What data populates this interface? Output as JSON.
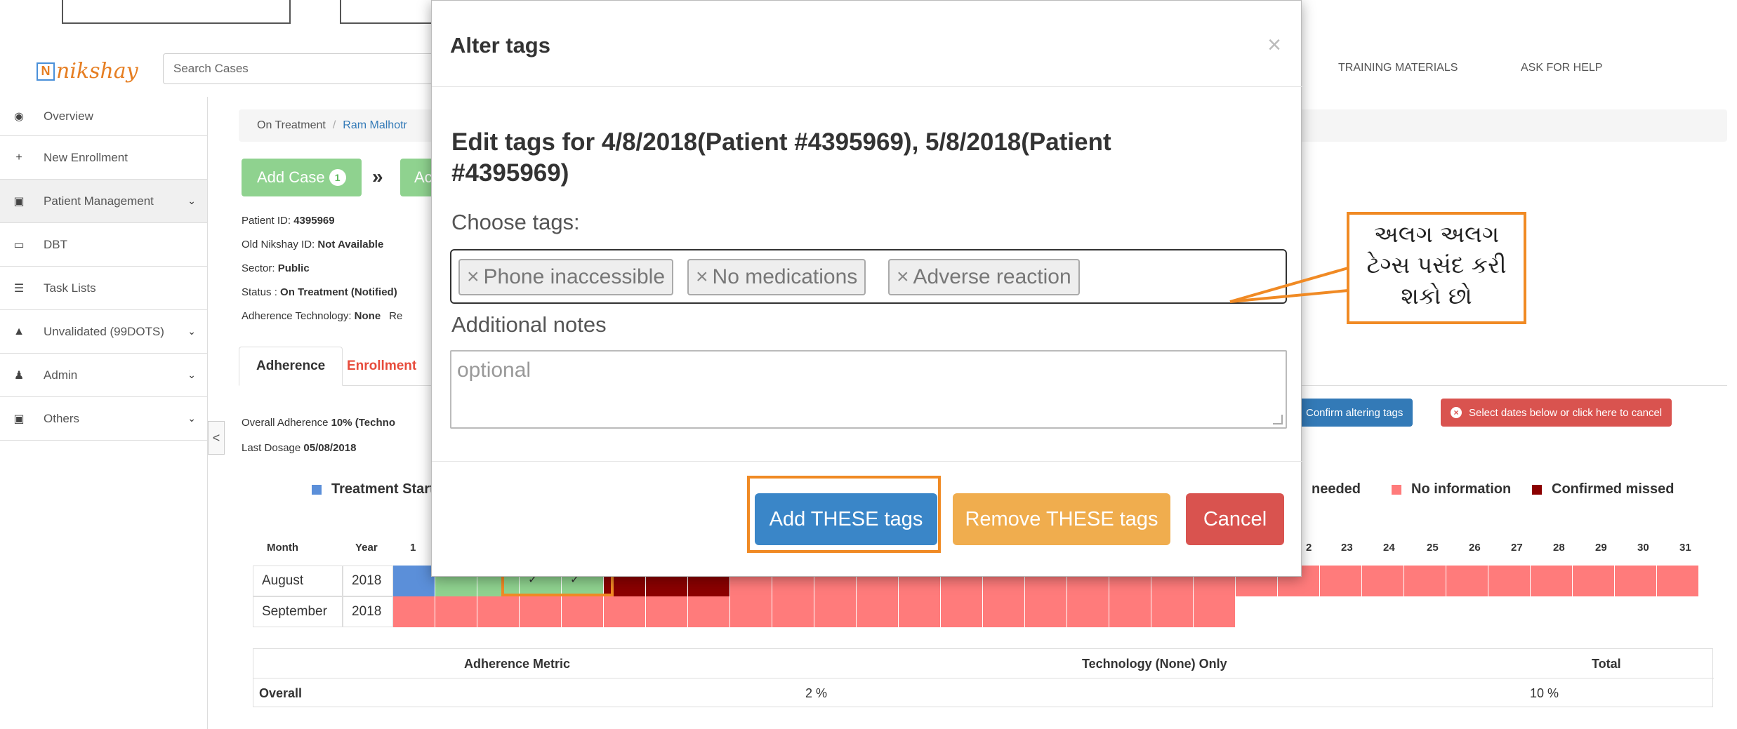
{
  "header": {
    "logo_text": "nikshay",
    "search_placeholder": "Search Cases",
    "nav": [
      "TRAINING MATERIALS",
      "ASK FOR HELP"
    ]
  },
  "sidebar": {
    "items": [
      {
        "label": "Overview",
        "icon": "dashboard-icon",
        "chevron": false
      },
      {
        "label": "New Enrollment",
        "icon": "plus-icon",
        "chevron": false
      },
      {
        "label": "Patient Management",
        "icon": "briefcase-icon",
        "chevron": true
      },
      {
        "label": "DBT",
        "icon": "money-icon",
        "chevron": false
      },
      {
        "label": "Task Lists",
        "icon": "list-icon",
        "chevron": false
      },
      {
        "label": "Unvalidated (99DOTS)",
        "icon": "warning-icon",
        "chevron": true
      },
      {
        "label": "Admin",
        "icon": "user-icon",
        "chevron": true
      },
      {
        "label": "Others",
        "icon": "briefcase-icon",
        "chevron": true
      }
    ],
    "collapse": "<"
  },
  "breadcrumb": {
    "first": "On Treatment",
    "sep": "/",
    "second": "Ram Malhotr"
  },
  "actions": {
    "add_case": "Add Case",
    "add_case_badge": "1",
    "arrows": "»",
    "next_fragment": "Ac"
  },
  "patient_info": {
    "patient_id_label": "Patient ID: ",
    "patient_id": "4395969",
    "old_id_label": "Old Nikshay ID: ",
    "old_id": "Not Available",
    "sector_label": "Sector: ",
    "sector": "Public",
    "status_label": "Status : ",
    "status": "On Treatment (Notified)",
    "tech_label": "Adherence Technology: ",
    "tech": "None",
    "tech_trailing": "Re"
  },
  "tabs": [
    "Adherence",
    "Enrollment"
  ],
  "adherence": {
    "overall_label": "Overall Adherence ",
    "overall_value": "10% (Techno",
    "last_dosage_label": "Last Dosage ",
    "last_dosage": "05/08/2018"
  },
  "tag_buttons": {
    "confirm": "Confirm altering tags",
    "cancel": "Select dates below or click here to cancel"
  },
  "legend": [
    {
      "label": "Treatment Start",
      "color": "#5b8fd9"
    },
    {
      "label": "needed",
      "color": null
    },
    {
      "label": "No information",
      "color": "#ff7b7b"
    },
    {
      "label": "Confirmed missed",
      "color": "#8b0000"
    }
  ],
  "calendar": {
    "month_header": "Month",
    "year_header": "Year",
    "day_headers": [
      "1",
      "2",
      "23",
      "24",
      "25",
      "26",
      "27",
      "28",
      "29",
      "30",
      "31"
    ],
    "rows": [
      {
        "month": "August",
        "year": "2018"
      },
      {
        "month": "September",
        "year": "2018"
      }
    ],
    "check": "✓"
  },
  "metric_table": {
    "headers": [
      "Adherence Metric",
      "Technology (None) Only",
      "Total"
    ],
    "row": [
      "Overall",
      "2 %",
      "10 %"
    ]
  },
  "modal": {
    "title": "Alter tags",
    "close": "×",
    "heading": "Edit tags for 4/8/2018(Patient #4395969), 5/8/2018(Patient #4395969)",
    "choose_label": "Choose tags:",
    "tags": [
      "Phone inaccessible",
      "No medications",
      "Adverse reaction"
    ],
    "tag_remove": "×",
    "notes_label": "Additional notes",
    "notes_placeholder": "optional",
    "buttons": {
      "add": "Add THESE tags",
      "remove": "Remove THESE tags",
      "cancel": "Cancel"
    }
  },
  "annotation": {
    "text": "અલગ અલગ ટેગ્સ પસંદ કરી શકો છો"
  },
  "colors": {
    "orange": "#f08a24",
    "blue": "#3a86c8",
    "yellow": "#f0ad4e",
    "red": "#d9534f",
    "pink": "#ff7b7b",
    "darkred": "#8b0000",
    "green": "#8fd28f",
    "treatment_blue": "#5b8fd9"
  }
}
